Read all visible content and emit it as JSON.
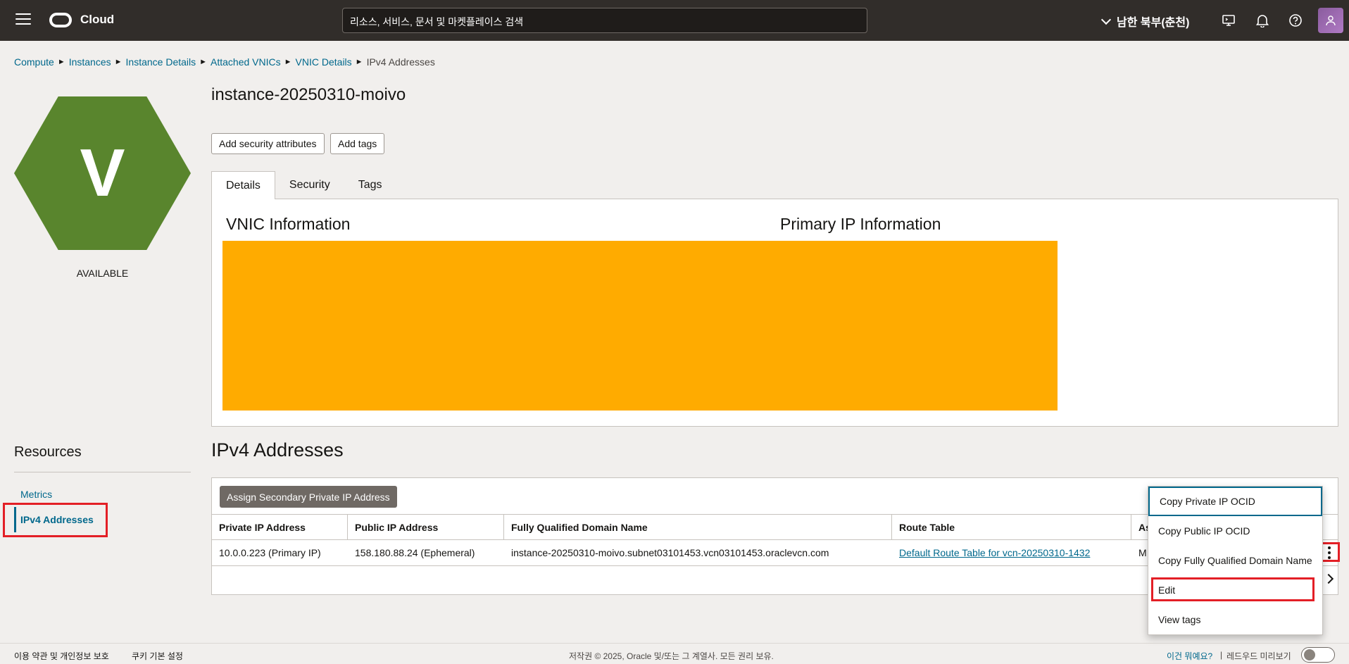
{
  "topbar": {
    "brand": "Cloud",
    "search_placeholder": "리소스, 서비스, 문서 및 마켓플레이스 검색",
    "region": "남한 북부(춘천)"
  },
  "breadcrumb": {
    "items": [
      "Compute",
      "Instances",
      "Instance Details",
      "Attached VNICs",
      "VNIC Details"
    ],
    "current": "IPv4 Addresses"
  },
  "resource": {
    "initial": "V",
    "status": "AVAILABLE",
    "hex_color": "#59852d"
  },
  "page": {
    "title": "instance-20250310-moivo",
    "add_security_attributes": "Add security attributes",
    "add_tags": "Add tags"
  },
  "tabs": [
    {
      "label": "Details",
      "active": true
    },
    {
      "label": "Security",
      "active": false
    },
    {
      "label": "Tags",
      "active": false
    }
  ],
  "details_panel": {
    "vnic_info": "VNIC Information",
    "primary_ip_info": "Primary IP Information"
  },
  "resources": {
    "title": "Resources",
    "items": [
      {
        "label": "Metrics",
        "active": false
      },
      {
        "label": "IPv4 Addresses",
        "active": true
      }
    ]
  },
  "ipv4": {
    "title": "IPv4 Addresses",
    "assign_button": "Assign Secondary Private IP Address",
    "columns": [
      "Private IP Address",
      "Public IP Address",
      "Fully Qualified Domain Name",
      "Route Table",
      "As"
    ],
    "rows": [
      {
        "private_ip": "10.0.0.223 (Primary IP)",
        "public_ip": "158.180.88.24 (Ephemeral)",
        "fqdn": "instance-20250310-moivo.subnet03101453.vcn03101453.oraclevcn.com",
        "route_table": "Default Route Table for vcn-20250310-1432",
        "extra": "M"
      }
    ]
  },
  "context_menu": {
    "items": [
      "Copy Private IP OCID",
      "Copy Public IP OCID",
      "Copy Fully Qualified Domain Name",
      "Edit",
      "View tags"
    ]
  },
  "footer": {
    "terms": "이용 약관 및 개인정보 보호",
    "cookies": "쿠키 기본 설정",
    "copyright": "저작권 © 2025, Oracle 및/또는 그 계열사. 모든 권리 보유.",
    "whats_this": "이건 뭐예요?",
    "separator": "|",
    "redwood_preview": "레드우드 미리보기"
  },
  "colors": {
    "topbar": "#312d2a",
    "link": "#00688c",
    "highlight": "#e31f26",
    "redaction": "#ffab00"
  }
}
